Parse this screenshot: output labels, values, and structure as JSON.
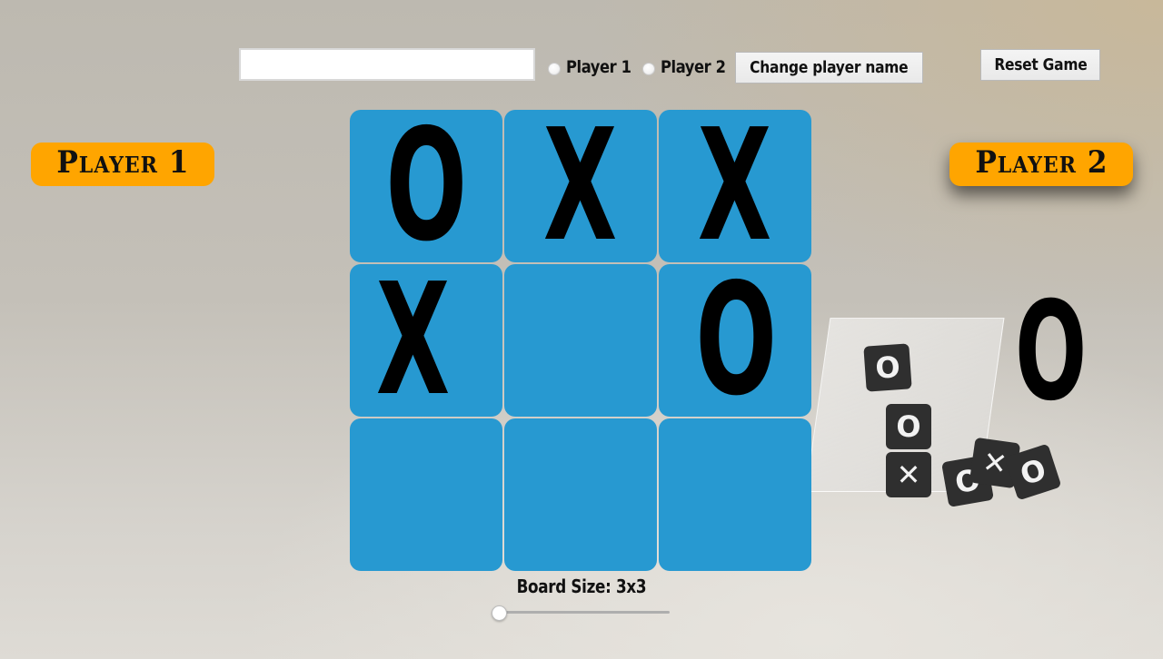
{
  "controls": {
    "name_input_value": "",
    "name_input_placeholder": "",
    "radio_player1_label": "Player 1",
    "radio_player2_label": "Player 2",
    "radio_selected": null,
    "change_name_label": "Change player name",
    "reset_label": "Reset Game"
  },
  "players": [
    {
      "name": "Player 1",
      "symbol": "X",
      "active": false
    },
    {
      "name": "Player 2",
      "symbol": "O",
      "active": true
    }
  ],
  "turn_indicator": "O",
  "board": {
    "size_label": "Board Size: 3x3",
    "size": 3,
    "slider": {
      "min": 3,
      "max": 10,
      "value": 3
    },
    "cells": [
      [
        "O",
        "X",
        "X"
      ],
      [
        "X",
        "",
        "O"
      ],
      [
        "",
        "",
        ""
      ]
    ],
    "cell_color": "#2799d1"
  },
  "colors": {
    "badge": "#ffa500",
    "mark": "#000000"
  }
}
